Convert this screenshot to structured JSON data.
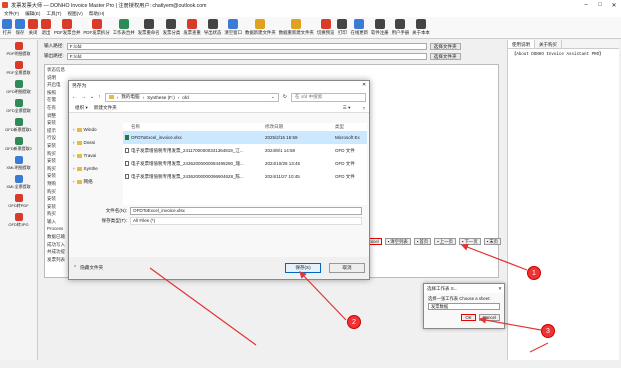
{
  "window": {
    "title": "发票发票大师 — DONHO Invoice Master Pro | 注册授权用户: chatlyem@outlook.com"
  },
  "menu": [
    "文件(F)",
    "编辑(E)",
    "工具(T)",
    "视图(V)",
    "帮助(H)"
  ],
  "toolbar": [
    {
      "label": "打开",
      "color": "#3a7bd5"
    },
    {
      "label": "保存",
      "color": "#3a7bd5"
    },
    {
      "label": "关闭",
      "color": "#d93a2a"
    },
    {
      "label": "退出",
      "color": "#d93a2a"
    },
    {
      "label": "PDF发票合并",
      "color": "#d93a2a"
    },
    {
      "label": "PDF发票拆分",
      "color": "#d93a2a"
    },
    {
      "label": "工作表合并",
      "color": "#2e8b57"
    },
    {
      "label": "发票重命名",
      "color": "#444"
    },
    {
      "label": "发票分类",
      "color": "#444"
    },
    {
      "label": "发票查重",
      "color": "#d93a2a"
    },
    {
      "label": "导出状态",
      "color": "#444"
    },
    {
      "label": "清空窗口",
      "color": "#3a7bd5"
    },
    {
      "label": "数据新建文件夹",
      "color": "#e0a020"
    },
    {
      "label": "数据重新建文件夹",
      "color": "#e0a020"
    },
    {
      "label": "切换预览",
      "color": "#d93a2a"
    },
    {
      "label": "打印",
      "color": "#444"
    },
    {
      "label": "在线更新",
      "color": "#3a7bd5"
    },
    {
      "label": "软件注册",
      "color": "#444"
    },
    {
      "label": "用户手册",
      "color": "#444"
    },
    {
      "label": "关于本本",
      "color": "#444"
    }
  ],
  "sidebar": [
    {
      "label": "PDF明细提取",
      "color": "#d93a2a"
    },
    {
      "label": "PDF全票提取",
      "color": "#d93a2a"
    },
    {
      "label": "OFD明细提取",
      "color": "#2e8b57"
    },
    {
      "label": "OFD全票提取",
      "color": "#2e8b57"
    },
    {
      "label": "OFD新票提取1",
      "color": "#2e8b57"
    },
    {
      "label": "OFD新票提取2",
      "color": "#2e8b57"
    },
    {
      "label": "XML明细提取",
      "color": "#3a7bd5"
    },
    {
      "label": "XML全票提取",
      "color": "#3a7bd5"
    },
    {
      "label": "OFD转PDF",
      "color": "#d93a2a"
    },
    {
      "label": "OFD转JPG",
      "color": "#d93a2a"
    }
  ],
  "main": {
    "input_label": "输入路径:",
    "input_value": "F:/ofd",
    "output_label": "输出路径:",
    "output_value": "F:/ofd",
    "select_file_btn": "选择文件夹",
    "status_header": "状态信息",
    "status_lines": [
      "说明",
      "开启电",
      "按照",
      "在需",
      "在有",
      "调整",
      "安装",
      "提示",
      "行设",
      "安装",
      "购买",
      "安装",
      "购买",
      "安装",
      "预购",
      "购买",
      "安装",
      "安装",
      "购买",
      "输入",
      "Process",
      "数据已输",
      "成功写入",
      "共成功提",
      "发票列表"
    ]
  },
  "bottombar": [
    {
      "label": "导入Excel",
      "active": true
    },
    {
      "label": "清空列表",
      "active": false
    },
    {
      "label": "首页",
      "active": false
    },
    {
      "label": "上一页",
      "active": false
    },
    {
      "label": "下一页",
      "active": false
    },
    {
      "label": "末页",
      "active": false
    }
  ],
  "rightpanel": {
    "tabs": [
      "使用说明",
      "关于购买"
    ],
    "content": "【About DONHO Invoice Assistant PRO】"
  },
  "file_dialog": {
    "title": "另存为",
    "breadcrumb": [
      "我的电脑",
      "Synthese (F:)",
      "ofd"
    ],
    "search_placeholder": "在 ofd 中搜索",
    "organize": "组织 ▾",
    "new_folder": "新建文件夹",
    "tree": [
      "Windo",
      "Dossi",
      "Travai",
      "Synthe",
      "网络"
    ],
    "columns": [
      "名称",
      "修改日期",
      "类型"
    ],
    "files": [
      {
        "name": "OFDToExcel_invoice.xlsx",
        "date": "2025/2/15 15:59",
        "type": "Microsoft Ex",
        "selected": true,
        "excel": true
      },
      {
        "name": "电子发票增值税专用发票_24117000000341364819_江...",
        "date": "2024/8/1 14:58",
        "type": "OFD 文件",
        "selected": false,
        "excel": false
      },
      {
        "name": "电子发票增值税专用发票_24362000000084495290_瑞...",
        "date": "2024/10/28 13:45",
        "type": "OFD 文件",
        "selected": false,
        "excel": false
      },
      {
        "name": "电子发票增值税专用发票_24362000000096904628_陈...",
        "date": "2024/11/27 10:45",
        "type": "OFD 文件",
        "selected": false,
        "excel": false
      }
    ],
    "filename_label": "文件名(N):",
    "filename_value": "OFDToExcel_invoice.xlsx",
    "filetype_label": "保存类型(T):",
    "filetype_value": "All Files (*)",
    "hide_folders": "隐藏文件夹",
    "save": "保存(S)",
    "cancel": "取消"
  },
  "sheet_dialog": {
    "title": "选择工作表 S...",
    "prompt": "选择一张工作表 Choose a sheet:",
    "selected": "发票数据",
    "ok": "OK",
    "cancel": "Cancel"
  },
  "badges": [
    "1",
    "2",
    "3"
  ],
  "colors": {
    "annotation": "#e33333",
    "selection": "#cce8ff"
  }
}
